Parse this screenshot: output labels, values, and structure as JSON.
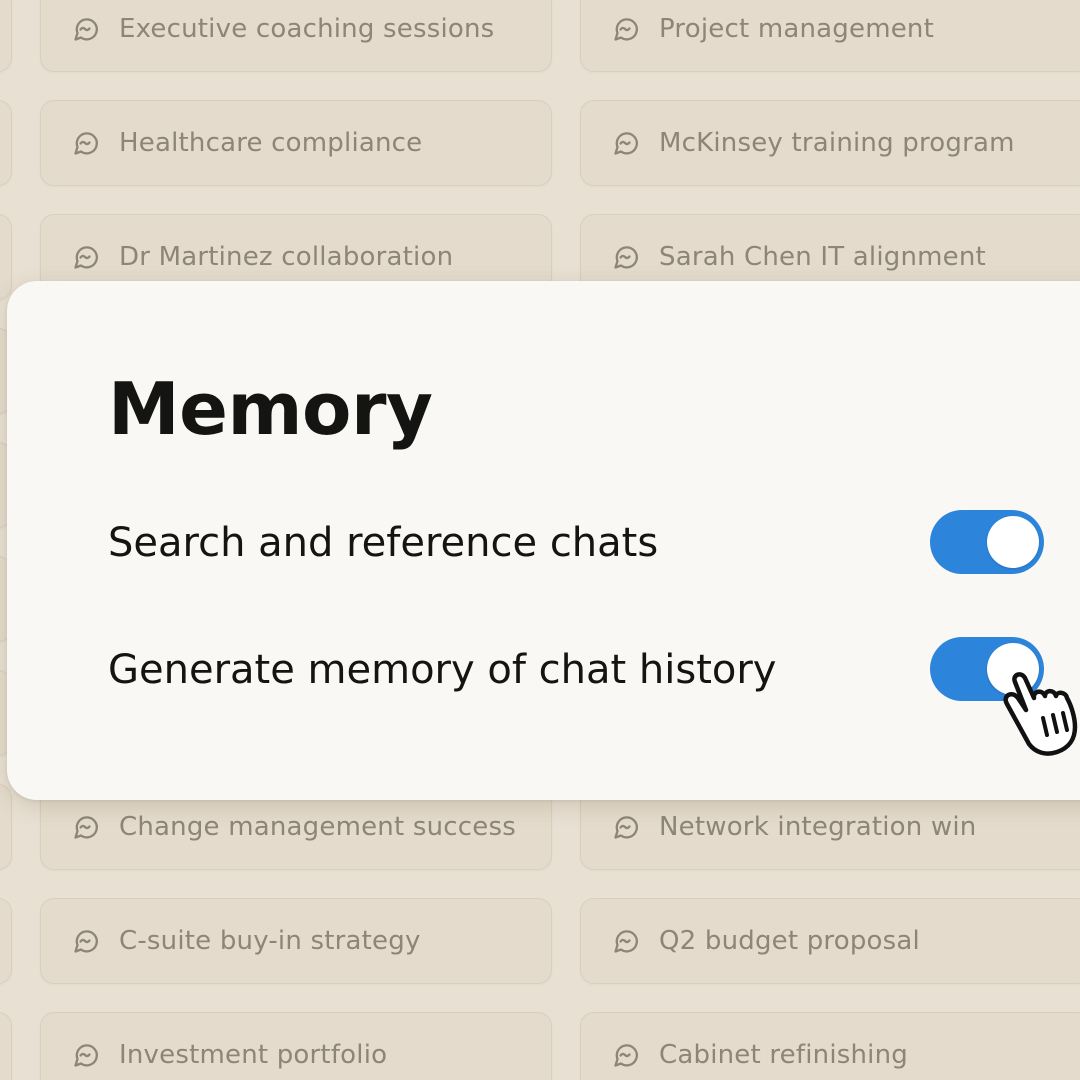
{
  "colors": {
    "background": "#e8e0d3",
    "card": "#e4dbcc",
    "panel": "#f9f8f5",
    "toggle_on": "#2c84db",
    "text_primary": "#141413",
    "text_muted": "#8d857a"
  },
  "chat_icon": "chat-bubble-icon",
  "chats": [
    {
      "title": ""
    },
    {
      "title": "Executive coaching sessions"
    },
    {
      "title": "Project management"
    },
    {
      "title": ""
    },
    {
      "title": "Healthcare compliance"
    },
    {
      "title": "McKinsey training program"
    },
    {
      "title": ""
    },
    {
      "title": "Dr Martinez collaboration"
    },
    {
      "title": "Sarah Chen IT alignment"
    },
    {
      "title": ""
    },
    {
      "title": ""
    },
    {
      "title": ""
    },
    {
      "title": ""
    },
    {
      "title": ""
    },
    {
      "title": ""
    },
    {
      "title": ""
    },
    {
      "title": ""
    },
    {
      "title": ""
    },
    {
      "title": ""
    },
    {
      "title": ""
    },
    {
      "title": ""
    },
    {
      "title": ""
    },
    {
      "title": "Change management success"
    },
    {
      "title": "Network integration win"
    },
    {
      "title": ""
    },
    {
      "title": "C-suite buy-in strategy"
    },
    {
      "title": "Q2 budget proposal"
    },
    {
      "title": ""
    },
    {
      "title": "Investment portfolio"
    },
    {
      "title": "Cabinet refinishing"
    }
  ],
  "memory_panel": {
    "title": "Memory",
    "settings": [
      {
        "label": "Search and reference chats",
        "enabled": true
      },
      {
        "label": "Generate memory of chat history",
        "enabled": true
      }
    ]
  },
  "pointer": "hand-pointer-cursor-icon"
}
